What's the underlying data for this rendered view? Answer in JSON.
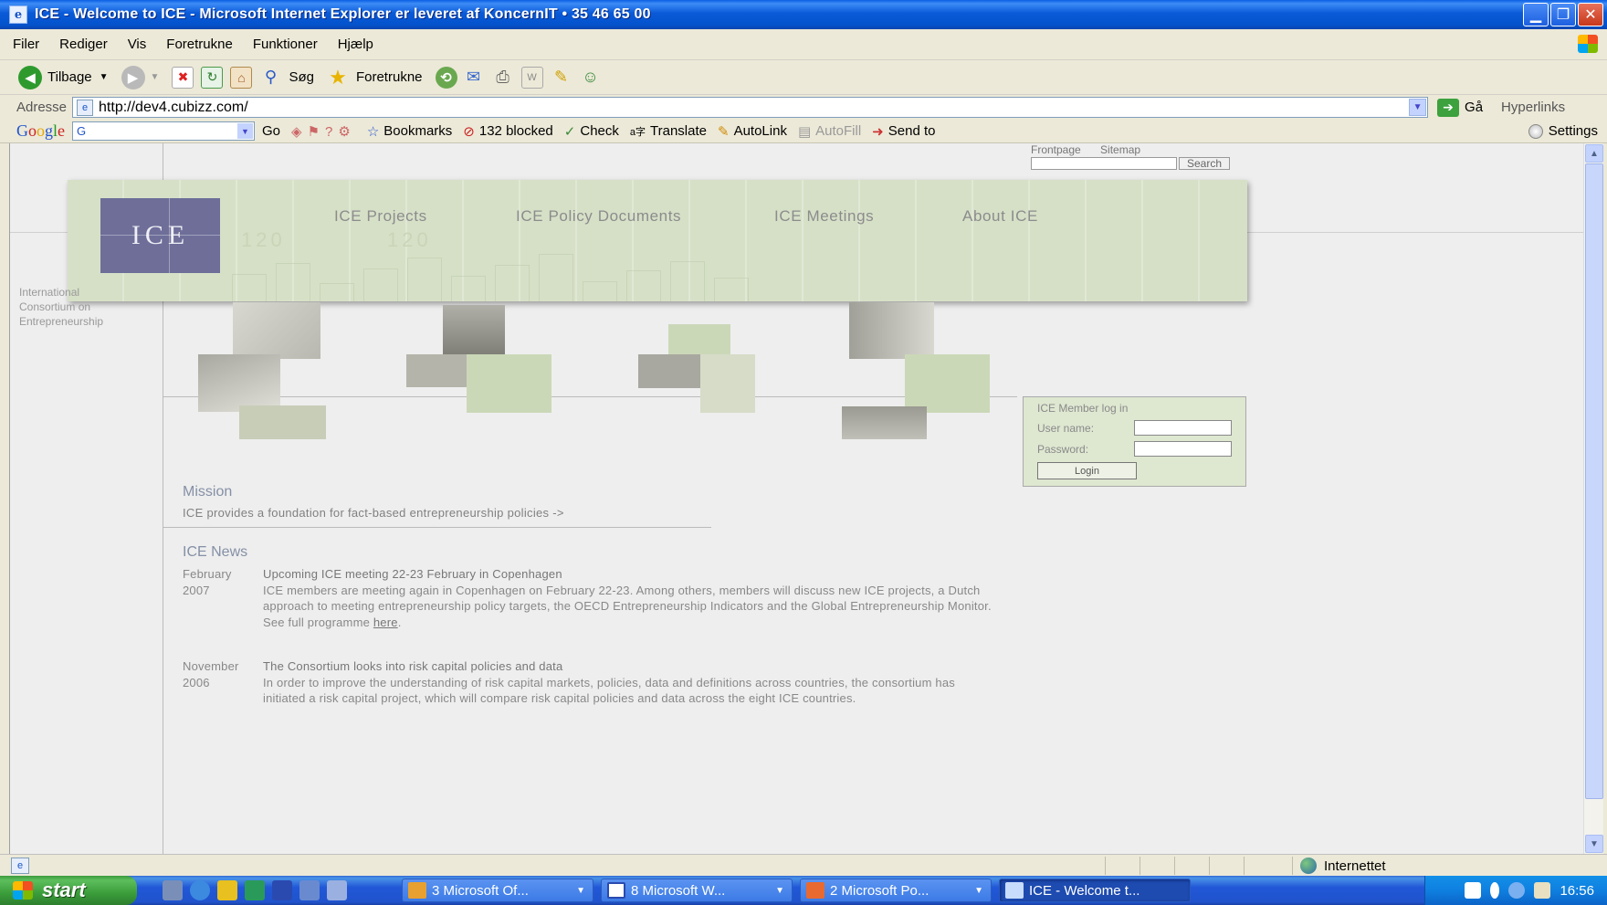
{
  "window": {
    "title": "ICE - Welcome to ICE - Microsoft Internet Explorer er leveret af KoncernIT • 35 46 65 00"
  },
  "menu": [
    "Filer",
    "Rediger",
    "Vis",
    "Foretrukne",
    "Funktioner",
    "Hjælp"
  ],
  "toolbar": {
    "back_label": "Tilbage",
    "search_label": "Søg",
    "favorites_label": "Foretrukne"
  },
  "address": {
    "label": "Adresse",
    "url": "http://dev4.cubizz.com/",
    "go_label": "Gå",
    "hyperlinks_label": "Hyperlinks"
  },
  "googlebar": {
    "logo": "Google",
    "search_prefix": "G",
    "go_label": "Go",
    "bookmarks_label": "Bookmarks",
    "blocked_label": "132 blocked",
    "check_label": "Check",
    "translate_label": "Translate",
    "autolink_label": "AutoLink",
    "autofill_label": "AutoFill",
    "sendto_label": "Send to",
    "settings_label": "Settings"
  },
  "page": {
    "top_links": {
      "frontpage": "Frontpage",
      "sitemap": "Sitemap",
      "search_button": "Search"
    },
    "logo_text": "ICE",
    "nav": [
      "ICE Projects",
      "ICE Policy Documents",
      "ICE Meetings",
      "About ICE"
    ],
    "hero_faint_numbers": [
      "120",
      "120"
    ],
    "side_text": [
      "International",
      "Consortium on",
      "Entrepreneurship"
    ],
    "login": {
      "title": "ICE Member log in",
      "username_label": "User name:",
      "password_label": "Password:",
      "button_label": "Login"
    },
    "mission": {
      "title": "Mission",
      "text": "ICE provides a foundation for fact-based entrepreneurship policies ->"
    },
    "news": {
      "title": "ICE News",
      "items": [
        {
          "month": "February",
          "year": "2007",
          "headline": "Upcoming ICE meeting 22-23 February in Copenhagen",
          "body": "ICE members are meeting again in Copenhagen on February 22-23. Among others, members will discuss new ICE projects, a Dutch approach to meeting entrepreneurship policy targets, the OECD Entrepreneurship Indicators and the Global Entrepreneurship Monitor. See full programme",
          "link": "here"
        },
        {
          "month": "November",
          "year": "2006",
          "headline": "The Consortium looks into risk capital policies and data",
          "body": "In order to improve the understanding of risk capital markets, policies, data and definitions across countries, the consortium has initiated a risk capital project, which will compare risk capital policies and data across the eight ICE countries."
        }
      ]
    }
  },
  "statusbar": {
    "zone": "Internettet"
  },
  "taskbar": {
    "start_label": "start",
    "tasks": [
      "3 Microsoft Of...",
      "8 Microsoft W...",
      "2 Microsoft Po...",
      "ICE - Welcome t..."
    ],
    "clock": "16:56"
  },
  "colors": {
    "hero_bg": "#D6E0C7",
    "logo_bg": "#6E6E99",
    "section_title": "#8490a6"
  }
}
